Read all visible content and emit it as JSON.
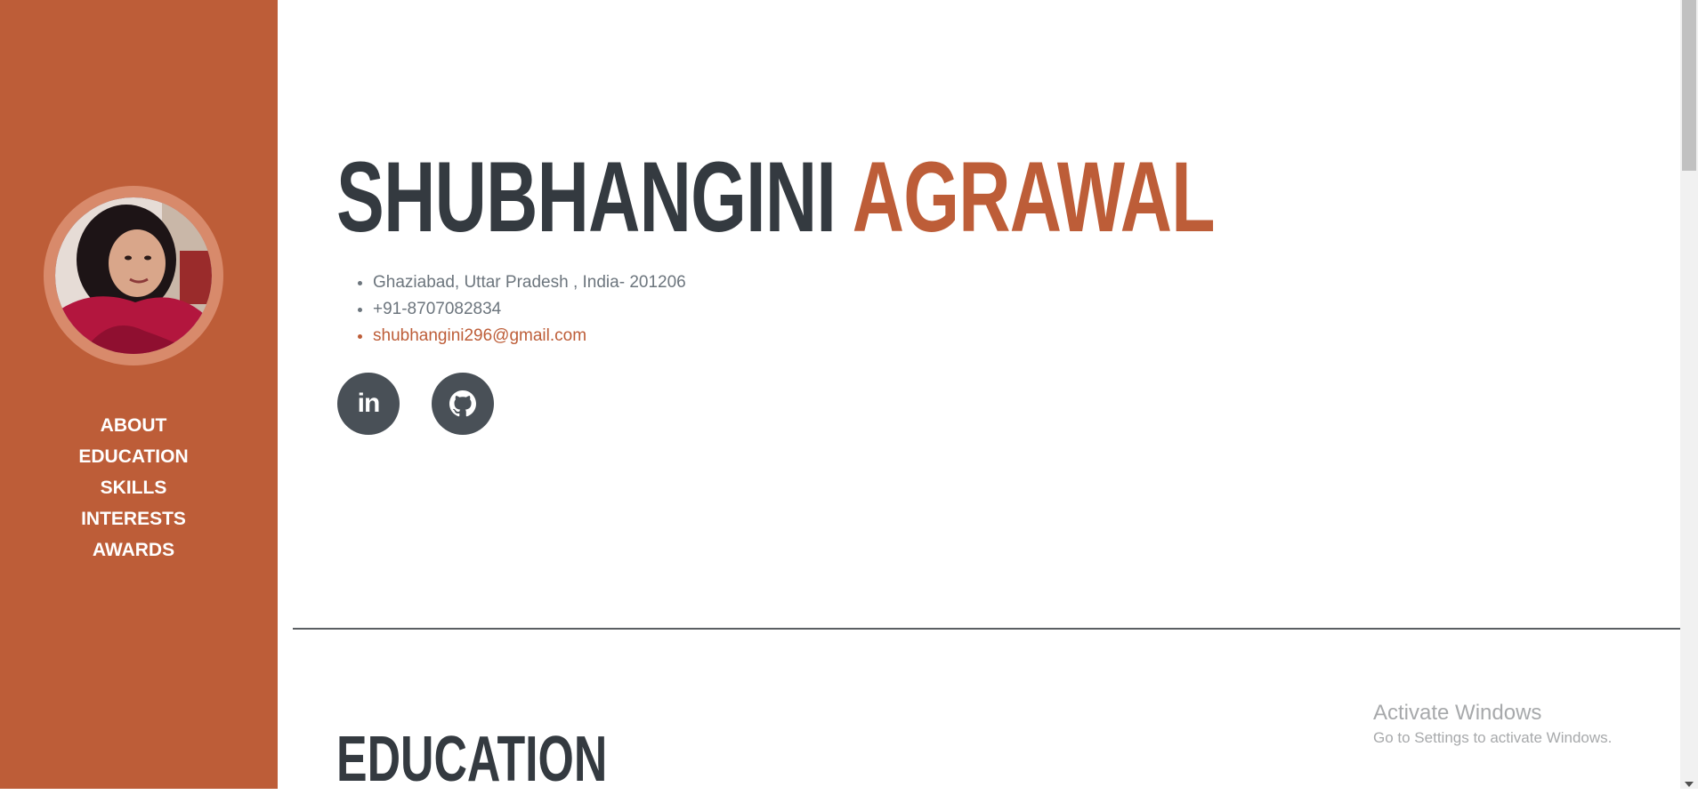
{
  "sidebar": {
    "avatar_alt": "profile photo",
    "nav": [
      "ABOUT",
      "EDUCATION",
      "SKILLS",
      "INTERESTS",
      "AWARDS"
    ]
  },
  "header": {
    "first_name": "SHUBHANGINI",
    "last_name": "AGRAWAL"
  },
  "contact": {
    "address": "Ghaziabad, Uttar Pradesh , India- 201206",
    "phone": "+91-8707082834",
    "email": "shubhangini296@gmail.com"
  },
  "social": [
    {
      "name": "linkedin",
      "icon": "linkedin-icon",
      "text": "in"
    },
    {
      "name": "github",
      "icon": "github-icon"
    }
  ],
  "sections": {
    "education_heading": "EDUCATION"
  },
  "watermark": {
    "title": "Activate Windows",
    "subtitle": "Go to Settings to activate Windows."
  },
  "colors": {
    "accent": "#bd5d38",
    "dark": "#343a40",
    "muted": "#6c757d",
    "icon_bg": "#495057"
  }
}
